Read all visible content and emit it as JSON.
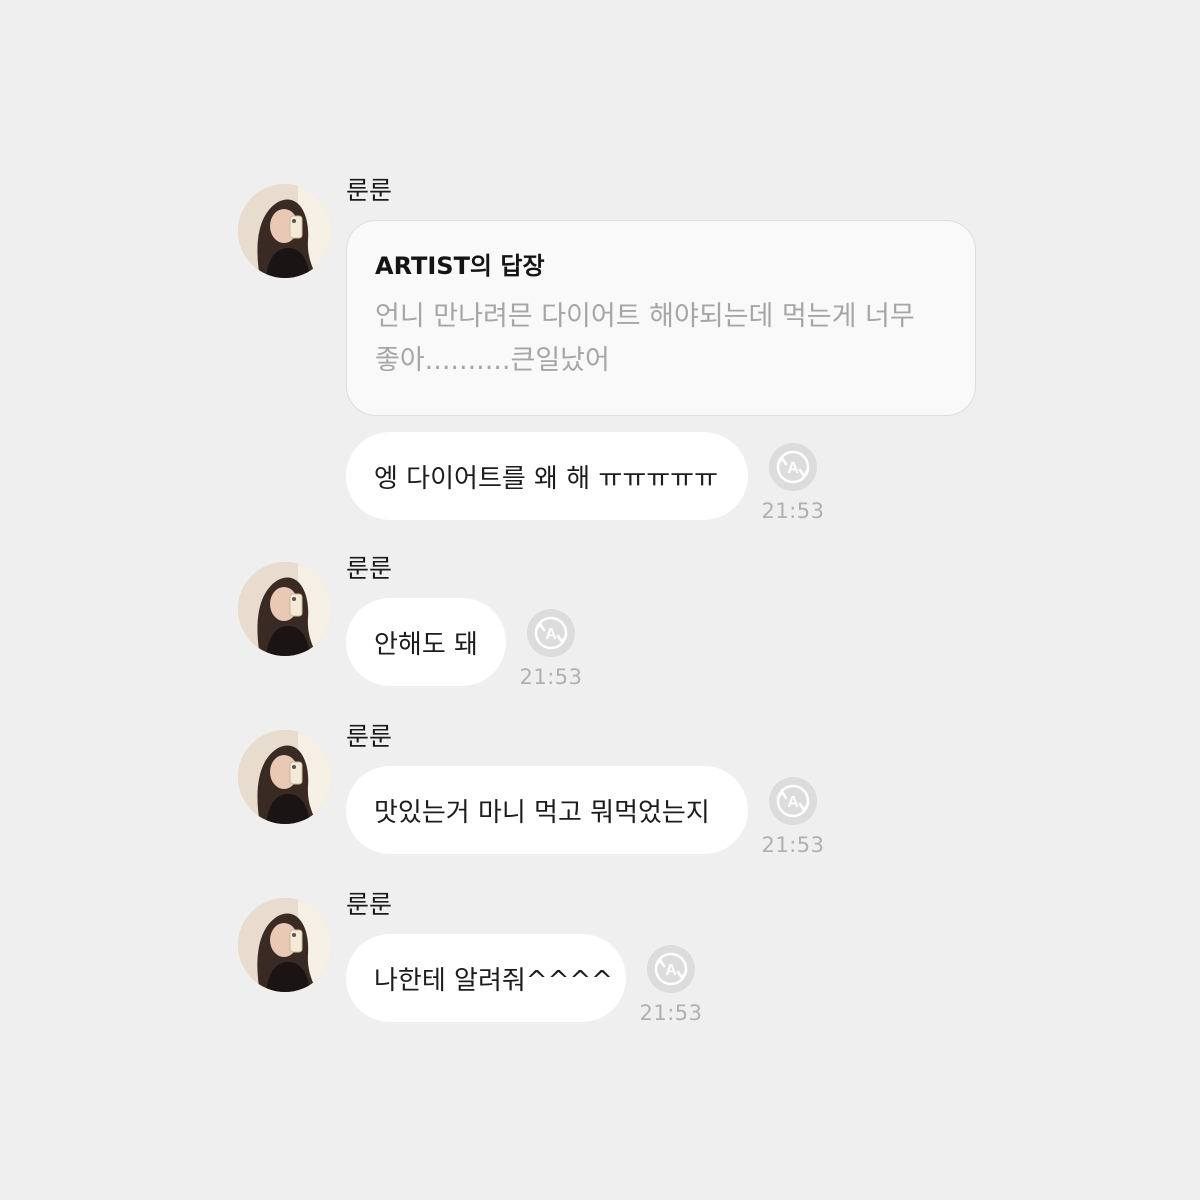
{
  "messages": [
    {
      "sender": "룬룬",
      "reply": {
        "title": "ARTIST의 답장",
        "quote": "언니 만나려믄 다이어트 해야되는데 먹는게 너무 좋아..........큰일났어"
      },
      "text": "엥 다이어트를 왜 해 ㅠㅠㅠㅠㅠ",
      "time": "21:53",
      "translate_icon": "translate-icon"
    },
    {
      "sender": "룬룬",
      "text": "안해도 돼",
      "time": "21:53",
      "translate_icon": "translate-icon"
    },
    {
      "sender": "룬룬",
      "text": "맛있는거 마니 먹고 뭐먹었는지",
      "time": "21:53",
      "translate_icon": "translate-icon"
    },
    {
      "sender": "룬룬",
      "text": "나한테 알려줘^^^^",
      "time": "21:53",
      "translate_icon": "translate-icon"
    }
  ],
  "colors": {
    "background": "#efefef",
    "bubble": "#ffffff",
    "reply_card": "#f9f9f9",
    "quote_text": "#a6a6a6",
    "timestamp": "#b0b0b0",
    "icon": "#cfcfcf"
  }
}
